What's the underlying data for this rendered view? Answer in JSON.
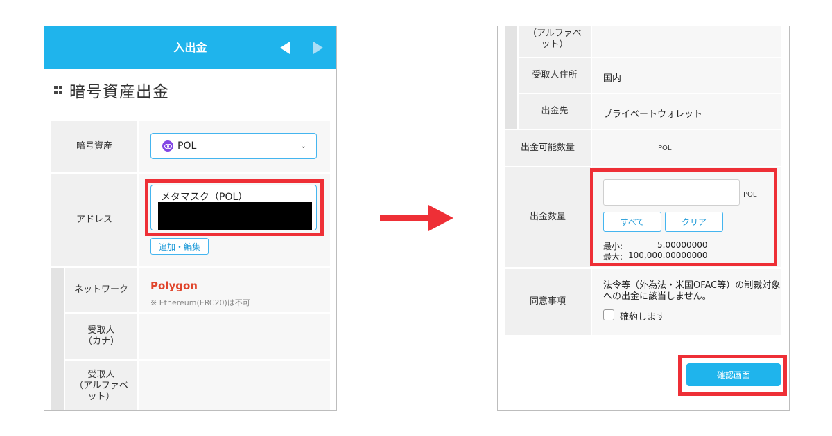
{
  "left_screen": {
    "header_title": "入出金",
    "page_title": "暗号資産出金",
    "crypto_label": "暗号資産",
    "crypto_selected": "POL",
    "address_label": "アドレス",
    "address_value": "メタマスク（POL）",
    "add_edit_button": "追加・編集",
    "network_label": "ネットワーク",
    "network_value": "Polygon",
    "network_note": "※ Ethereum(ERC20)は不可",
    "recipient_kana_label_1": "受取人",
    "recipient_kana_label_2": "（カナ）",
    "recipient_alpha_label_1": "受取人",
    "recipient_alpha_label_2": "（アルファベ",
    "recipient_alpha_label_3": "ット）"
  },
  "right_screen": {
    "top_label_1": "（アルファベ",
    "top_label_2": "ット）",
    "recipient_address_label": "受取人住所",
    "recipient_address_value": "国内",
    "destination_label": "出金先",
    "destination_value": "プライベートウォレット",
    "available_label": "出金可能数量",
    "available_unit": "POL",
    "amount_label": "出金数量",
    "amount_unit": "POL",
    "all_button": "すべて",
    "clear_button": "クリア",
    "min_label": "最小:",
    "min_value": "5.00000000",
    "max_label": "最大:",
    "max_value": "100,000.00000000",
    "consent_label": "同意事項",
    "consent_text": "法令等（外為法・米国OFAC等）の制裁対象への出金に該当しません。",
    "agree_label": "確約します",
    "confirm_button": "確認画面"
  },
  "colors": {
    "header": "#1fb4ec",
    "highlight": "#ee2f36",
    "network": "#e0452c",
    "polygon": "#8247e5"
  }
}
